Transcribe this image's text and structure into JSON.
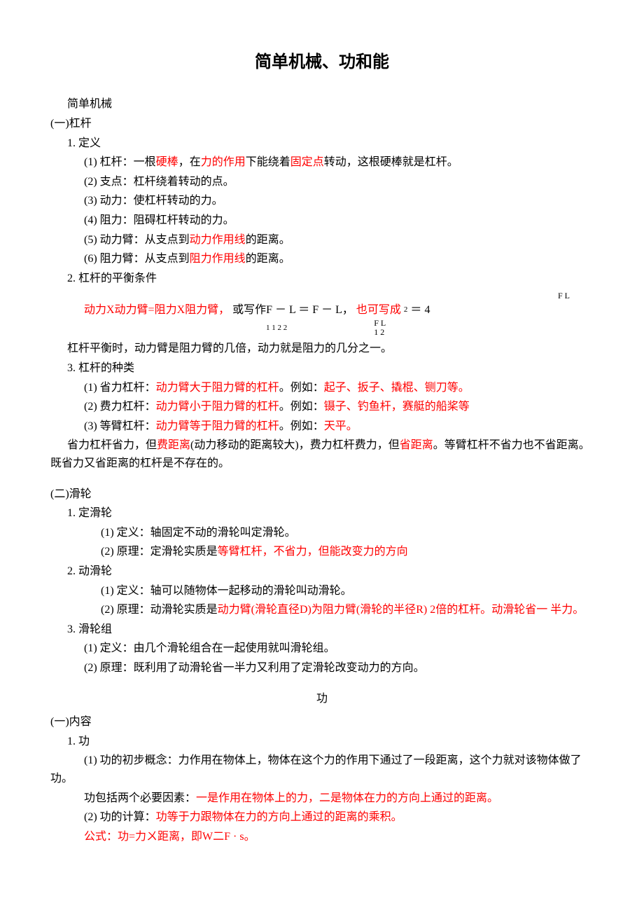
{
  "title": "简单机械、功和能",
  "s1_header": "简单机械",
  "s1_a": "(一)杠杆",
  "s1_a_1": "1. 定义",
  "s1_a_1_1_pre": "(1) 杠杆：一根",
  "s1_a_1_1_red1": "硬棒",
  "s1_a_1_1_mid": "，在",
  "s1_a_1_1_red2": "力的作用",
  "s1_a_1_1_mid2": "下能绕着",
  "s1_a_1_1_red3": "固定点",
  "s1_a_1_1_tail": "转动，这根硬棒就是杠杆。",
  "s1_a_1_2": "(2) 支点：杠杆绕着转动的点。",
  "s1_a_1_3": "(3) 动力：使杠杆转动的力。",
  "s1_a_1_4": "(4) 阻力：阻碍杠杆转动的力。",
  "s1_a_1_5_pre": "(5) 动力臂：从支点到",
  "s1_a_1_5_red": "动力作用线",
  "s1_a_1_5_tail": "的距离。",
  "s1_a_1_6_pre": "(6) 阻力臂：从支点到",
  "s1_a_1_6_red": "阻力作用线",
  "s1_a_1_6_tail": "的距离。",
  "s1_a_2": "2. 杠杆的平衡条件",
  "formula_red1": "动力X动力臂=阻力X阻力臂，",
  "formula_mid": "或写作F － L ＝ F － L，",
  "formula_red2": "也可写成",
  "formula_sub": "2",
  "formula_eq": "＝",
  "formula_rhs": "4",
  "formula_sub_line": "1 1                  2 2",
  "formula_frac_top": "F L",
  "formula_frac_bot": "F L\n1 2",
  "s1_a_2_note": "杠杆平衡时，动力臂是阻力臂的几倍，动力就是阻力的几分之一。",
  "s1_a_3": "3. 杠杆的种类",
  "s1_a_3_1_pre": "(1) 省力杠杆：",
  "s1_a_3_1_red": "动力臂大于阻力臂的杠杆",
  "s1_a_3_1_mid": "。例如：",
  "s1_a_3_1_red2": "起子、扳子、撬棍、铡刀等。",
  "s1_a_3_2_pre": "(2) 费力杠杆：",
  "s1_a_3_2_red": "动力臂小于阻力臂的杠杆",
  "s1_a_3_2_mid": "。例如：",
  "s1_a_3_2_red2": "镊子、钓鱼杆，赛艇的船桨等",
  "s1_a_3_3_pre": "(3) 等臂杠杆：",
  "s1_a_3_3_red": "动力臂等于阻力臂的杠杆",
  "s1_a_3_3_mid": "。例如：",
  "s1_a_3_3_red2": "天平。",
  "s1_a_note_pre": "省力杠杆省力，但",
  "s1_a_note_red1": "费距离",
  "s1_a_note_mid": "(动力移动的距离较大)，费力杠杆费力，但",
  "s1_a_note_red2": "省距离",
  "s1_a_note_tail": "。等臂杠杆不省力也不省距离。既省力又省距离的杠杆是不存在的。",
  "s2_a": "(二)滑轮",
  "s2_a_1": "1. 定滑轮",
  "s2_a_1_1": "(1) 定义：轴固定不动的滑轮叫定滑轮。",
  "s2_a_1_2_pre": "(2) 原理：定滑轮实质是",
  "s2_a_1_2_red": "等臂杠杆，不省力，但能改变力的方向",
  "s2_a_2": "2. 动滑轮",
  "s2_a_2_1": "(1) 定义：轴可以随物体一起移动的滑轮叫动滑轮。",
  "s2_a_2_2_pre": "(2) 原理：动滑轮实质是",
  "s2_a_2_2_red": "动力臂(滑轮直径D)为阻力臂(滑轮的半径R)  2倍的杠杆。动滑轮省一 半力。",
  "s2_a_3": "3. 滑轮组",
  "s2_a_3_1": "(1) 定义：由几个滑轮组合在一起使用就叫滑轮组。",
  "s2_a_3_2": "(2) 原理：既利用了动滑轮省一半力又利用了定滑轮改变动力的方向。",
  "gong_heading": "功",
  "s3_a": "(一)内容",
  "s3_a_1": "1. 功",
  "s3_a_1_1": "(1) 功的初步概念：力作用在物体上，物体在这个力的作用下通过了一段距离，这个力就对该物体做了功。",
  "s3_a_1_note_pre": "功包括两个必要因素：",
  "s3_a_1_note_red": "一是作用在物体上的力，二是物体在力的方向上通过的距离。",
  "s3_a_1_2_pre": "(2) 功的计算：",
  "s3_a_1_2_red": "功等于力跟物体在力的方向上通过的距离的乘积。",
  "s3_formula_pre": "公式：功=力ㄨ距离，即W二F · s。"
}
